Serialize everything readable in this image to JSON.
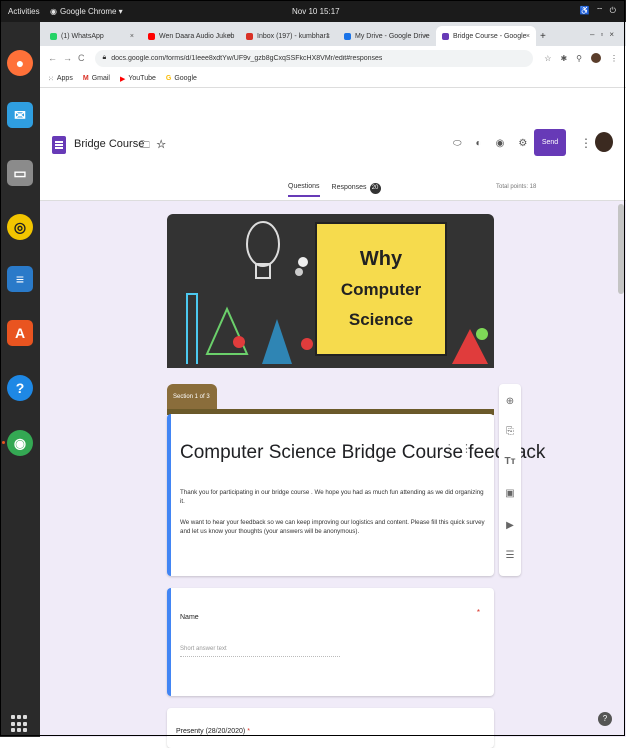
{
  "topbar": {
    "activities": "Activities",
    "app_name": "Google Chrome ▾",
    "clock": "Nov 10 15:17"
  },
  "tabs": [
    {
      "label": "(1) WhatsApp",
      "color": "#25d366"
    },
    {
      "label": "Wen Daara Audio Jukeb",
      "color": "#ff0000"
    },
    {
      "label": "Inbox (197) - kumbhar1",
      "color": "#d93025"
    },
    {
      "label": "My Drive - Google Drive",
      "color": "#1a73e8"
    },
    {
      "label": "Bridge Course - Google",
      "color": "#673ab7"
    }
  ],
  "address": {
    "url": "docs.google.com/forms/d/1Ieee8xdtYw/UF9v_gzb8gCxqSSFkcHX8VMr/edit#responses"
  },
  "bookmarks": [
    {
      "label": "Apps",
      "color": "#555555"
    },
    {
      "label": "Gmail",
      "color": "#d93025"
    },
    {
      "label": "YouTube",
      "color": "#ff0000"
    },
    {
      "label": "Google",
      "color": "#fbbc04"
    }
  ],
  "form_header": {
    "title": "Bridge Course",
    "send_label": "Send",
    "tabs": [
      "Questions",
      "Responses"
    ],
    "responses_count": "20",
    "total_points": "Total points: 18"
  },
  "banner": {
    "line1": "Why",
    "line2": "Computer",
    "line3": "Science"
  },
  "section_tag": "Section 1 of 3",
  "title_card": {
    "title": "Computer Science Bridge Course feedback",
    "desc1": "Thank you for participating in our bridge course . We hope you had as much fun attending as we did organizing it.",
    "desc2": "We want to hear your feedback so we can keep improving our logistics and content. Please fill this quick survey and let us know your thoughts (your answers will be anonymous)."
  },
  "name_card": {
    "label": "Name",
    "required_mark": "*",
    "placeholder": "Short answer text"
  },
  "presenty_card": {
    "label": "Presenty (28/20/2020)",
    "required_mark": "*"
  },
  "colors": {
    "accent": "#673ab7",
    "canvas": "#f0ebf8",
    "section": "#8a6d3b"
  }
}
